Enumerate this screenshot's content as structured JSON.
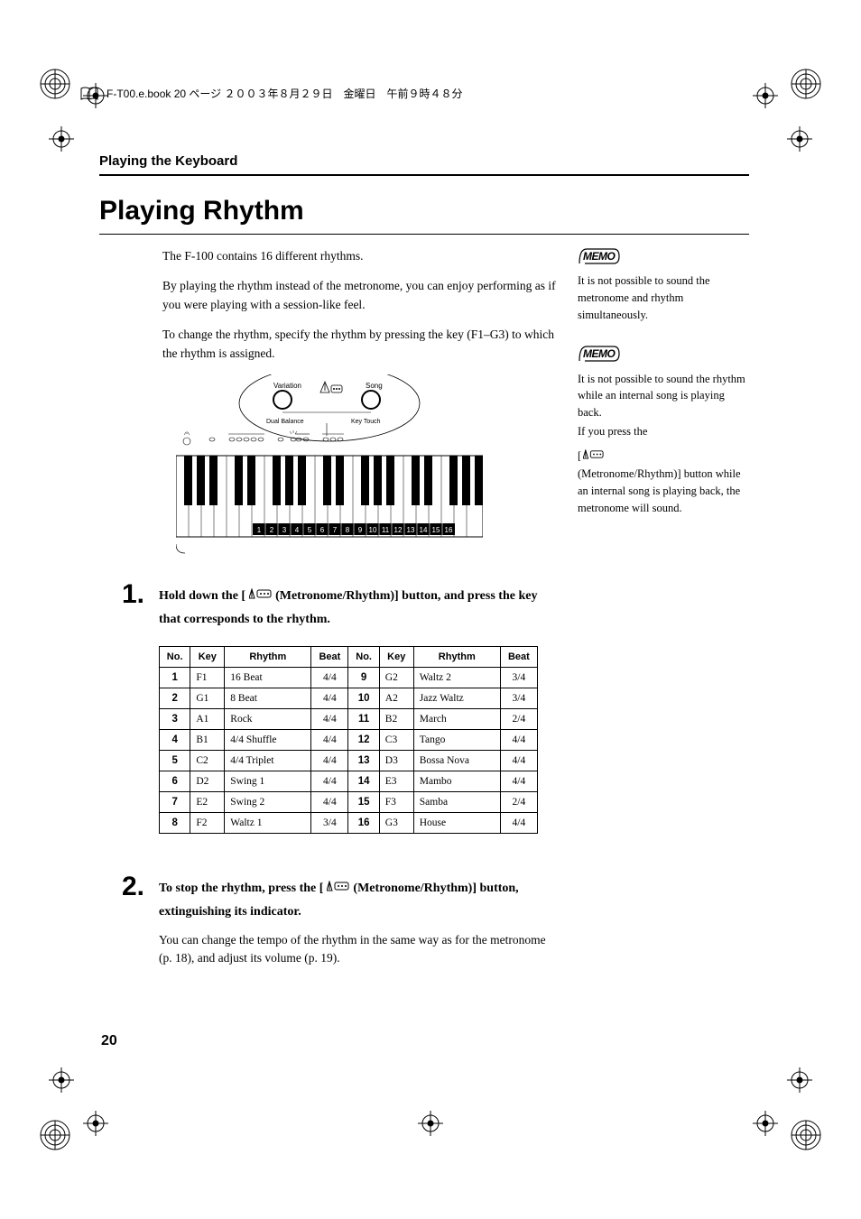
{
  "print_header": "F-T00.e.book 20 ページ ２００３年８月２９日　金曜日　午前９時４８分",
  "running_header": "Playing the Keyboard",
  "title": "Playing Rhythm",
  "paras": [
    "The F-100 contains 16 different rhythms.",
    "By playing the rhythm instead of the metronome, you can enjoy performing as if you were playing with a session-like feel.",
    "To change the rhythm, specify the rhythm by pressing the key (F1–G3) to which the rhythm is assigned."
  ],
  "memo1": "It is not possible to sound the metronome and rhythm simultaneously.",
  "memo2a": "It is not possible to sound the rhythm while an internal song is playing back.",
  "memo2b": "If you press the",
  "memo2c_prefix": "[ ",
  "memo2c_suffix": " (Metronome/Rhythm)] button while an internal song is playing back, the metronome will sound.",
  "diagram_labels": {
    "variation": "Variation",
    "song": "Song",
    "dual_balance": "Dual Balance",
    "key_touch": "Key Touch"
  },
  "step1a": "Hold down the [ ",
  "step1b": " (Metronome/Rhythm)] button, and press the key that corresponds to the rhythm.",
  "step2a": "To stop the rhythm, press the [ ",
  "step2b": " (Metronome/Rhythm)] button, extinguishing its indicator.",
  "step2c": "You can change the tempo of the rhythm in the same way as for the metronome (p. 18), and adjust its volume (p. 19).",
  "table_headers": [
    "No.",
    "Key",
    "Rhythm",
    "Beat"
  ],
  "rows_left": [
    {
      "no": "1",
      "key": "F1",
      "rhythm": "16 Beat",
      "beat": "4/4"
    },
    {
      "no": "2",
      "key": "G1",
      "rhythm": "8 Beat",
      "beat": "4/4"
    },
    {
      "no": "3",
      "key": "A1",
      "rhythm": "Rock",
      "beat": "4/4"
    },
    {
      "no": "4",
      "key": "B1",
      "rhythm": "4/4 Shuffle",
      "beat": "4/4"
    },
    {
      "no": "5",
      "key": "C2",
      "rhythm": "4/4 Triplet",
      "beat": "4/4"
    },
    {
      "no": "6",
      "key": "D2",
      "rhythm": "Swing 1",
      "beat": "4/4"
    },
    {
      "no": "7",
      "key": "E2",
      "rhythm": "Swing 2",
      "beat": "4/4"
    },
    {
      "no": "8",
      "key": "F2",
      "rhythm": "Waltz 1",
      "beat": "3/4"
    }
  ],
  "rows_right": [
    {
      "no": "9",
      "key": "G2",
      "rhythm": "Waltz 2",
      "beat": "3/4"
    },
    {
      "no": "10",
      "key": "A2",
      "rhythm": "Jazz Waltz",
      "beat": "3/4"
    },
    {
      "no": "11",
      "key": "B2",
      "rhythm": "March",
      "beat": "2/4"
    },
    {
      "no": "12",
      "key": "C3",
      "rhythm": "Tango",
      "beat": "4/4"
    },
    {
      "no": "13",
      "key": "D3",
      "rhythm": "Bossa Nova",
      "beat": "4/4"
    },
    {
      "no": "14",
      "key": "E3",
      "rhythm": "Mambo",
      "beat": "4/4"
    },
    {
      "no": "15",
      "key": "F3",
      "rhythm": "Samba",
      "beat": "2/4"
    },
    {
      "no": "16",
      "key": "G3",
      "rhythm": "House",
      "beat": "4/4"
    }
  ],
  "page_number": "20"
}
